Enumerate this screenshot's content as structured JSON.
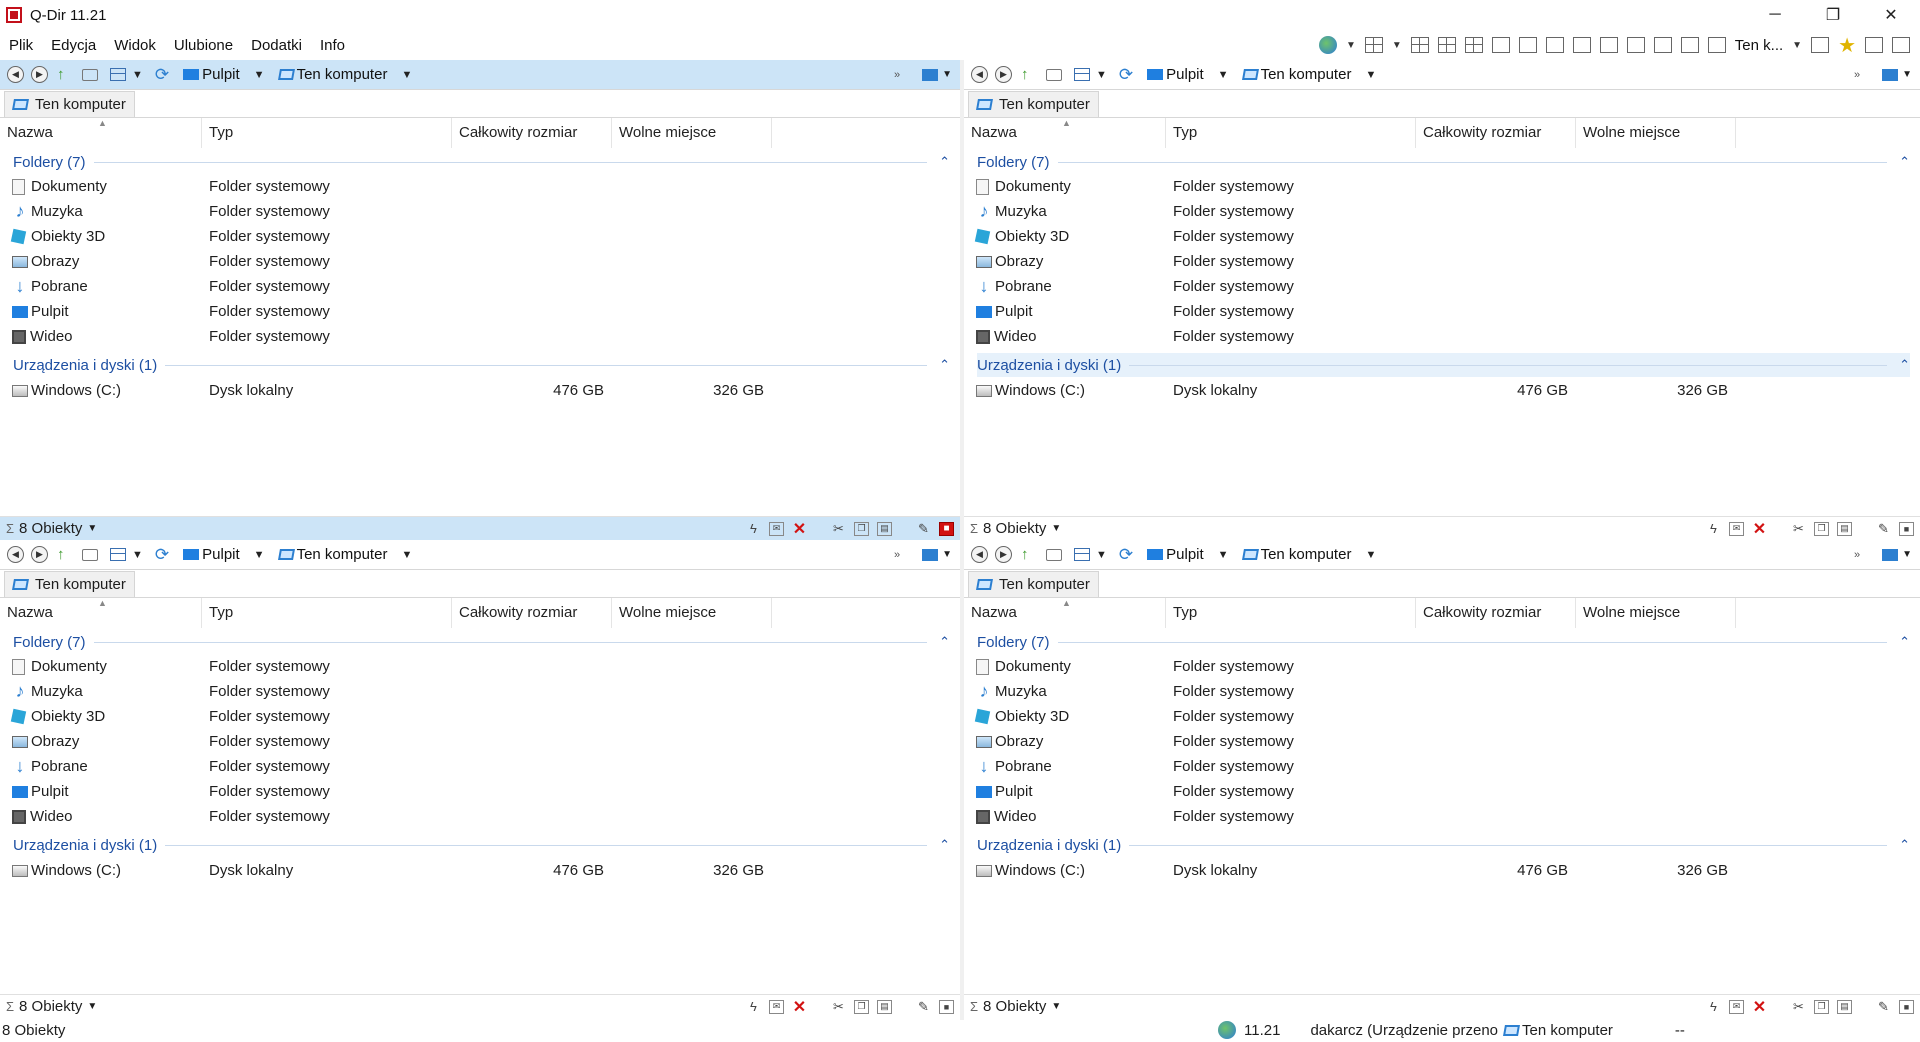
{
  "window": {
    "title": "Q-Dir 11.21",
    "minimize": "─",
    "maximize": "❐",
    "close": "✕"
  },
  "menu": [
    "Plik",
    "Edycja",
    "Widok",
    "Ulubione",
    "Dodatki",
    "Info"
  ],
  "main_toolbar": {
    "ten_label": "Ten k..."
  },
  "panes": [
    {
      "nav": {
        "desktop": "Pulpit",
        "computer": "Ten komputer"
      },
      "tab": "Ten komputer",
      "columns": [
        "Nazwa",
        "Typ",
        "Całkowity rozmiar",
        "Wolne miejsce"
      ],
      "groups": [
        {
          "label": "Foldery (7)",
          "items": [
            {
              "name": "Dokumenty",
              "type": "Folder systemowy",
              "icon": "document-icon"
            },
            {
              "name": "Muzyka",
              "type": "Folder systemowy",
              "icon": "music-icon"
            },
            {
              "name": "Obiekty 3D",
              "type": "Folder systemowy",
              "icon": "cube-icon"
            },
            {
              "name": "Obrazy",
              "type": "Folder systemowy",
              "icon": "pictures-icon"
            },
            {
              "name": "Pobrane",
              "type": "Folder systemowy",
              "icon": "download-icon"
            },
            {
              "name": "Pulpit",
              "type": "Folder systemowy",
              "icon": "desktop-icon"
            },
            {
              "name": "Wideo",
              "type": "Folder systemowy",
              "icon": "video-icon"
            }
          ]
        },
        {
          "label": "Urządzenia i dyski (1)",
          "items": [
            {
              "name": "Windows (C:)",
              "type": "Dysk lokalny",
              "size": "476 GB",
              "free": "326 GB",
              "icon": "drive-icon"
            }
          ]
        }
      ],
      "status": "8 Obiekty"
    },
    {
      "nav": {
        "desktop": "Pulpit",
        "computer": "Ten komputer"
      },
      "tab": "Ten komputer",
      "columns": [
        "Nazwa",
        "Typ",
        "Całkowity rozmiar",
        "Wolne miejsce"
      ],
      "groups": [
        {
          "label": "Foldery (7)",
          "items": [
            {
              "name": "Dokumenty",
              "type": "Folder systemowy",
              "icon": "document-icon"
            },
            {
              "name": "Muzyka",
              "type": "Folder systemowy",
              "icon": "music-icon"
            },
            {
              "name": "Obiekty 3D",
              "type": "Folder systemowy",
              "icon": "cube-icon"
            },
            {
              "name": "Obrazy",
              "type": "Folder systemowy",
              "icon": "pictures-icon"
            },
            {
              "name": "Pobrane",
              "type": "Folder systemowy",
              "icon": "download-icon"
            },
            {
              "name": "Pulpit",
              "type": "Folder systemowy",
              "icon": "desktop-icon"
            },
            {
              "name": "Wideo",
              "type": "Folder systemowy",
              "icon": "video-icon"
            }
          ]
        },
        {
          "label": "Urządzenia i dyski (1)",
          "items": [
            {
              "name": "Windows (C:)",
              "type": "Dysk lokalny",
              "size": "476 GB",
              "free": "326 GB",
              "icon": "drive-icon"
            }
          ]
        }
      ],
      "status": "8 Obiekty"
    },
    {
      "nav": {
        "desktop": "Pulpit",
        "computer": "Ten komputer"
      },
      "tab": "Ten komputer",
      "columns": [
        "Nazwa",
        "Typ",
        "Całkowity rozmiar",
        "Wolne miejsce"
      ],
      "groups": [
        {
          "label": "Foldery (7)",
          "items": [
            {
              "name": "Dokumenty",
              "type": "Folder systemowy",
              "icon": "document-icon"
            },
            {
              "name": "Muzyka",
              "type": "Folder systemowy",
              "icon": "music-icon"
            },
            {
              "name": "Obiekty 3D",
              "type": "Folder systemowy",
              "icon": "cube-icon"
            },
            {
              "name": "Obrazy",
              "type": "Folder systemowy",
              "icon": "pictures-icon"
            },
            {
              "name": "Pobrane",
              "type": "Folder systemowy",
              "icon": "download-icon"
            },
            {
              "name": "Pulpit",
              "type": "Folder systemowy",
              "icon": "desktop-icon"
            },
            {
              "name": "Wideo",
              "type": "Folder systemowy",
              "icon": "video-icon"
            }
          ]
        },
        {
          "label": "Urządzenia i dyski (1)",
          "items": [
            {
              "name": "Windows (C:)",
              "type": "Dysk lokalny",
              "size": "476 GB",
              "free": "326 GB",
              "icon": "drive-icon"
            }
          ]
        }
      ],
      "status": "8 Obiekty"
    },
    {
      "nav": {
        "desktop": "Pulpit",
        "computer": "Ten komputer"
      },
      "tab": "Ten komputer",
      "columns": [
        "Nazwa",
        "Typ",
        "Całkowity rozmiar",
        "Wolne miejsce"
      ],
      "groups": [
        {
          "label": "Foldery (7)",
          "items": [
            {
              "name": "Dokumenty",
              "type": "Folder systemowy",
              "icon": "document-icon"
            },
            {
              "name": "Muzyka",
              "type": "Folder systemowy",
              "icon": "music-icon"
            },
            {
              "name": "Obiekty 3D",
              "type": "Folder systemowy",
              "icon": "cube-icon"
            },
            {
              "name": "Obrazy",
              "type": "Folder systemowy",
              "icon": "pictures-icon"
            },
            {
              "name": "Pobrane",
              "type": "Folder systemowy",
              "icon": "download-icon"
            },
            {
              "name": "Pulpit",
              "type": "Folder systemowy",
              "icon": "desktop-icon"
            },
            {
              "name": "Wideo",
              "type": "Folder systemowy",
              "icon": "video-icon"
            }
          ]
        },
        {
          "label": "Urządzenia i dyski (1)",
          "items": [
            {
              "name": "Windows (C:)",
              "type": "Dysk lokalny",
              "size": "476 GB",
              "free": "326 GB",
              "icon": "drive-icon"
            }
          ]
        }
      ],
      "status": "8 Obiekty"
    }
  ],
  "bottom_status": {
    "left": "8 Obiekty",
    "version": "11.21",
    "user": "dakarcz (Urządzenie przeno",
    "location": "Ten komputer",
    "extra": "--"
  },
  "colors": {
    "active_pane": "#cce4f7",
    "group_text": "#1d4fa2"
  }
}
